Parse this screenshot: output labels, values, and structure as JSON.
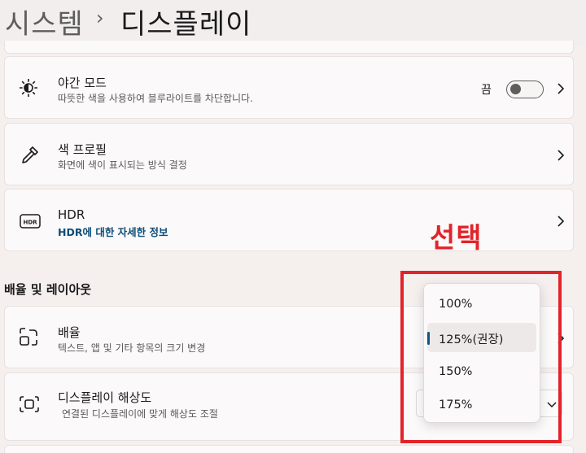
{
  "breadcrumb": {
    "root": "시스템",
    "separator": "›",
    "current": "디스플레이"
  },
  "night_light": {
    "title": "야간 모드",
    "description": "따뜻한 색을 사용하여 블루라이트를 차단합니다.",
    "toggle_state": "끔"
  },
  "color_profile": {
    "title": "색 프로필",
    "description": "화면에 색이 표시되는 방식 결정"
  },
  "hdr": {
    "title": "HDR",
    "link": "HDR에 대한 자세한 정보",
    "icon_text": "HDR"
  },
  "scale_layout": {
    "section_title": "배율 및 레이아웃"
  },
  "scale": {
    "title": "배율",
    "description": "텍스트, 앱 및 기타 항목의 크기 변경",
    "options": [
      "100%",
      "125%(권장)",
      "150%",
      "175%"
    ],
    "selected": "125%(권장)"
  },
  "resolution": {
    "title": "디스플레이 해상도",
    "description": "연결된 디스플레이에 맞게 해상도 조절"
  },
  "annotation": {
    "label": "선택",
    "color": "#e3232a"
  },
  "colors": {
    "accent": "#11557c",
    "link": "#0d4d79",
    "annotation": "#e3232a"
  }
}
